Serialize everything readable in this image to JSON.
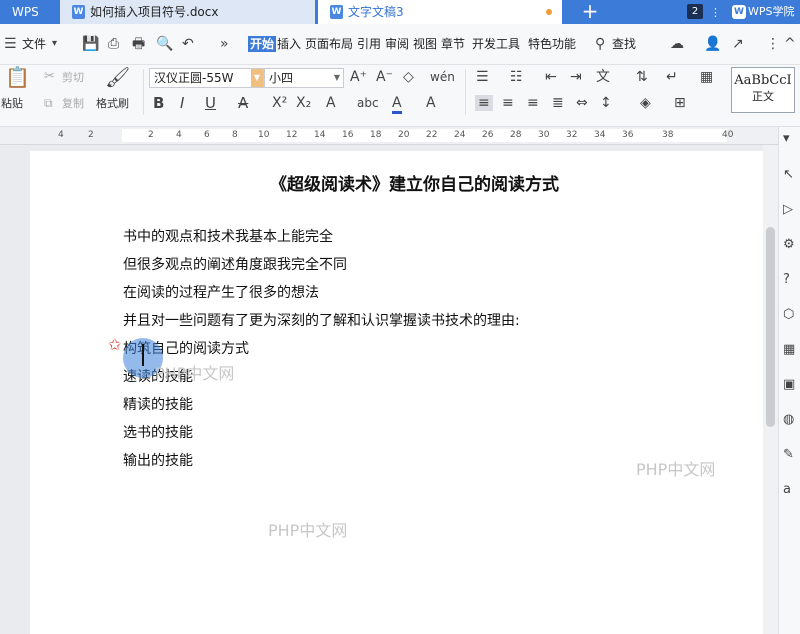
{
  "titlebar": {
    "app_label": "WPS",
    "tabs": [
      {
        "icon": "W",
        "label": "如何插入项目符号.docx"
      },
      {
        "icon": "W",
        "label": "文字文稿3"
      }
    ],
    "new_tab": "+",
    "window_count": "2",
    "account_icon": "W",
    "account_label": "WPS学院"
  },
  "menubar": {
    "file_label": "文件",
    "items": [
      "开始",
      "插入",
      "页面布局",
      "引用",
      "审阅",
      "视图",
      "章节",
      "开发工具",
      "特色功能"
    ],
    "search_label": "查找",
    "more_symbol": "»"
  },
  "ribbon": {
    "paste": "粘贴",
    "cut": "剪切",
    "copy": "复制",
    "format_painter": "格式刷",
    "font_name": "汉仪正圆-55W",
    "font_size": "小四",
    "bold": "B",
    "italic": "I",
    "underline": "U",
    "style_preview": "AaBbCcI",
    "style_name": "正文"
  },
  "ruler": {
    "ticks": [
      "4",
      "2",
      "2",
      "4",
      "6",
      "8",
      "10",
      "12",
      "14",
      "16",
      "18",
      "20",
      "22",
      "24",
      "26",
      "28",
      "30",
      "32",
      "34",
      "36",
      "38",
      "40"
    ]
  },
  "document": {
    "title": "《超级阅读术》建立你自己的阅读方式",
    "lines": [
      "书中的观点和技术我基本上能完全",
      "但很多观点的阐述角度跟我完全不同",
      "在阅读的过程产生了很多的想法",
      "并且对一些问题有了更为深刻的了解和认识掌握读书技术的理由:",
      "构筑自己的阅读方式",
      "速读的技能",
      "精读的技能",
      "选书的技能",
      "输出的技能"
    ],
    "watermark": "PHP中文网"
  }
}
